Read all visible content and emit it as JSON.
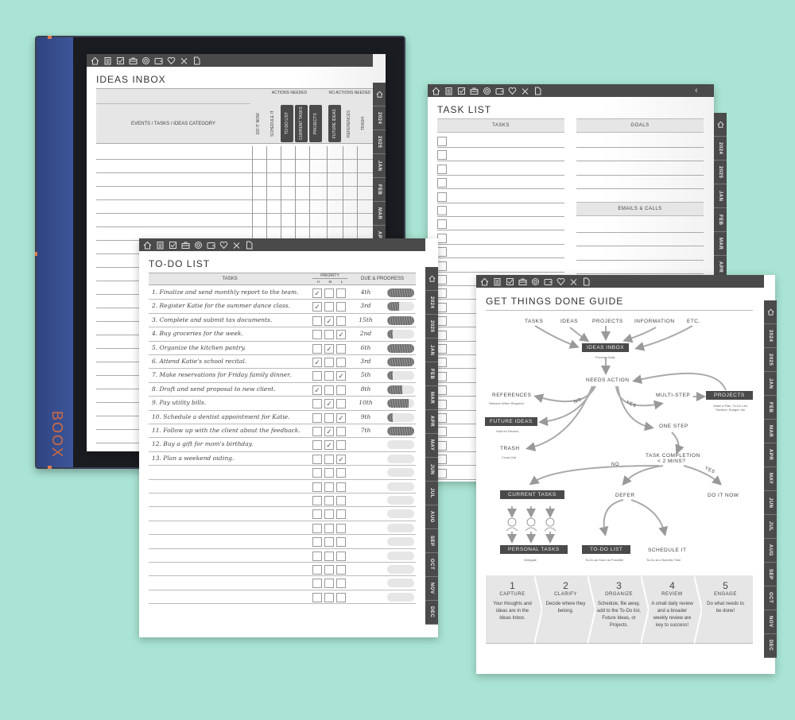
{
  "device": {
    "brand": "BOOX"
  },
  "toolbar_icons": [
    "home-icon",
    "clipboard-icon",
    "checkbox-icon",
    "briefcase-icon",
    "target-icon",
    "wallet-icon",
    "heart-icon",
    "tools-icon",
    "page-icon"
  ],
  "side_tabs": [
    "2024",
    "2025",
    "JAN",
    "FEB",
    "MAR",
    "APR",
    "MAY",
    "JUN",
    "JUL",
    "AUG",
    "SEP",
    "OCT",
    "NOV",
    "DEC"
  ],
  "ideas_inbox": {
    "title": "IDEAS INBOX",
    "category_header": "EVENTS / TASKS / IDEAS CATEGORY",
    "actions_needed": "ACTIONS NEEDED",
    "no_actions_needed": "NO ACTIONS NEEDED",
    "columns": [
      {
        "label": "DO IT NOW",
        "dark": false
      },
      {
        "label": "SCHEDULE IT",
        "dark": false
      },
      {
        "label": "TO-DO LIST",
        "dark": true
      },
      {
        "label": "CURRENT TASKS",
        "dark": true
      },
      {
        "label": "PROJECTS",
        "dark": true
      },
      {
        "label": "FUTURE IDEAS",
        "dark": true
      },
      {
        "label": "REFERENCES",
        "dark": false
      },
      {
        "label": "TRASH",
        "dark": false
      }
    ]
  },
  "task_list": {
    "title": "TASK LIST",
    "tasks_header": "TASKS",
    "goals_header": "GOALS",
    "emails_header": "EMAILS & CALLS",
    "back_icon": "chevron-left-icon"
  },
  "todo_list": {
    "title": "TO-DO LIST",
    "tasks_header": "TASKS",
    "priority_header": "PRIORITY",
    "priority_levels": [
      "H",
      "M",
      "L"
    ],
    "due_header": "DUE & PROGRESS",
    "rows": [
      {
        "text": "1. Finalize and send monthly report to the team.",
        "priority": "H",
        "due": "4th",
        "progress": 100
      },
      {
        "text": "2. Register Katie for the summer dance class.",
        "priority": "H",
        "due": "3rd",
        "progress": 45
      },
      {
        "text": "3. Complete and submit tax documents.",
        "priority": "M",
        "due": "15th",
        "progress": 100
      },
      {
        "text": "4. Buy groceries for the week.",
        "priority": "L",
        "due": "2nd",
        "progress": 20
      },
      {
        "text": "5. Organize the kitchen pantry.",
        "priority": "M",
        "due": "6th",
        "progress": 100
      },
      {
        "text": "6. Attend Katie's school recital.",
        "priority": "H",
        "due": "3rd",
        "progress": 100
      },
      {
        "text": "7. Make reservations for Friday family dinner.",
        "priority": "L",
        "due": "5th",
        "progress": 20
      },
      {
        "text": "8. Draft and send proposal to new client.",
        "priority": "H",
        "due": "8th",
        "progress": 55
      },
      {
        "text": "9. Pay utility bills.",
        "priority": "M",
        "due": "10th",
        "progress": 80
      },
      {
        "text": "10. Schedule a dentist appointment for Katie.",
        "priority": "L",
        "due": "9th",
        "progress": 20
      },
      {
        "text": "11. Follow up with the client about the feedback.",
        "priority": "M",
        "due": "7th",
        "progress": 100
      },
      {
        "text": "12. Buy a gift for mom's birthday.",
        "priority": "M",
        "due": "",
        "progress": 0
      },
      {
        "text": "13. Plan a weekend outing.",
        "priority": "L",
        "due": "",
        "progress": 0
      },
      {
        "text": "",
        "priority": "",
        "due": "",
        "progress": 0
      },
      {
        "text": "",
        "priority": "",
        "due": "",
        "progress": 0
      },
      {
        "text": "",
        "priority": "",
        "due": "",
        "progress": 0
      },
      {
        "text": "",
        "priority": "",
        "due": "",
        "progress": 0
      },
      {
        "text": "",
        "priority": "",
        "due": "",
        "progress": 0
      },
      {
        "text": "",
        "priority": "",
        "due": "",
        "progress": 0
      },
      {
        "text": "",
        "priority": "",
        "due": "",
        "progress": 0
      },
      {
        "text": "",
        "priority": "",
        "due": "",
        "progress": 0
      },
      {
        "text": "",
        "priority": "",
        "due": "",
        "progress": 0
      },
      {
        "text": "",
        "priority": "",
        "due": "",
        "progress": 0
      }
    ]
  },
  "gtd_guide": {
    "title": "GET THINGS DONE GUIDE",
    "inputs": [
      "TASKS",
      "IDEAS",
      "PROJECTS",
      "INFORMATION",
      "ETC."
    ],
    "ideas_inbox": "IDEAS INBOX",
    "ideas_inbox_sub": "Process Daily",
    "needs_action": "NEEDS ACTION",
    "no": "NO",
    "yes": "YES",
    "references": "REFERENCES",
    "references_sub": "Retrieve When Required",
    "future_ideas": "FUTURE IDEAS",
    "future_ideas_sub": "Hold for Review",
    "trash": "TRASH",
    "trash_sub": "Cross Out",
    "multi_step": "MULTI-STEP",
    "projects": "PROJECTS",
    "projects_sub": "Make a Plan, To-Do List, Timeline, Budget, etc.",
    "one_step": "ONE STEP",
    "task_completion": "TASK COMPLETION",
    "task_completion_2": "< 2 MINS?",
    "no2": "NO",
    "yes2": "YES",
    "current_tasks": "CURRENT TASKS",
    "defer": "DEFER",
    "do_it_now": "DO IT NOW",
    "personal_tasks": "PERSONAL TASKS",
    "personal_tasks_sub": "Delegate",
    "todo_list": "TO-DO LIST",
    "todo_list_sub": "To-Do as Soon as Possible",
    "schedule_it": "SCHEDULE IT",
    "schedule_it_sub": "To-Do at a Specific Time",
    "steps": [
      {
        "num": "1",
        "title": "CAPTURE",
        "desc": "Your thoughts and ideas are in the Ideas Inbox."
      },
      {
        "num": "2",
        "title": "CLARIFY",
        "desc": "Decide where they belong."
      },
      {
        "num": "3",
        "title": "ORGANIZE",
        "desc": "Schedule, file away, add to the To-Do list, Future Ideas, or Projects."
      },
      {
        "num": "4",
        "title": "REVIEW",
        "desc": "A small daily review and a broader weekly review are key to success!"
      },
      {
        "num": "5",
        "title": "ENGAGE",
        "desc": "Do what needs to be done!"
      }
    ]
  }
}
